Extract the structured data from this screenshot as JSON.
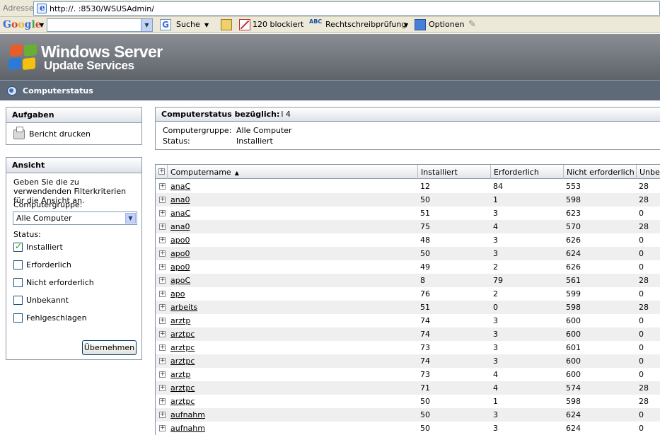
{
  "browser": {
    "address_label": "Adresse",
    "url": "http://.         :8530/WSUSAdmin/"
  },
  "google_toolbar": {
    "logo": "Google",
    "search_label": "Suche",
    "blocked_label": "120 blockiert",
    "spellcheck_label": "Rechtschreibprüfung",
    "options_label": "Optionen"
  },
  "banner": {
    "line1": "Windows Server",
    "line2": "Update Services"
  },
  "page": {
    "title": "Computerstatus"
  },
  "tasks": {
    "heading": "Aufgaben",
    "print_label": "Bericht drucken"
  },
  "view": {
    "heading": "Ansicht",
    "description": "Geben Sie die zu verwendenden Filterkriterien für die Ansicht an.",
    "group_label": "Computergruppe:",
    "group_value": "Alle Computer",
    "status_label": "Status:",
    "statuses": [
      {
        "label": "Installiert",
        "checked": true
      },
      {
        "label": "Erforderlich",
        "checked": false
      },
      {
        "label": "Nicht erforderlich",
        "checked": false
      },
      {
        "label": "Unbekannt",
        "checked": false
      },
      {
        "label": "Fehlgeschlagen",
        "checked": false
      }
    ],
    "apply_label": "Übernehmen"
  },
  "status_info": {
    "heading": "Computerstatus bezüglich:",
    "heading_value": "l          4",
    "rows": [
      {
        "key": "Computergruppe:",
        "value": "Alle Computer"
      },
      {
        "key": "Status:",
        "value": "Installiert"
      }
    ]
  },
  "table": {
    "columns": [
      "Computername",
      "Installiert",
      "Erforderlich",
      "Nicht erforderlich",
      "Unbekannt"
    ],
    "rows": [
      {
        "name": "anaC",
        "installed": "12",
        "required": "84",
        "not_required": "553",
        "unknown": "28"
      },
      {
        "name": "ana0",
        "installed": "50",
        "required": "1",
        "not_required": "598",
        "unknown": "28"
      },
      {
        "name": "anaC",
        "installed": "51",
        "required": "3",
        "not_required": "623",
        "unknown": "0"
      },
      {
        "name": "ana0",
        "installed": "75",
        "required": "4",
        "not_required": "570",
        "unknown": "28"
      },
      {
        "name": "apo0",
        "installed": "48",
        "required": "3",
        "not_required": "626",
        "unknown": "0"
      },
      {
        "name": "apo0",
        "installed": "50",
        "required": "3",
        "not_required": "624",
        "unknown": "0"
      },
      {
        "name": "apo0",
        "installed": "49",
        "required": "2",
        "not_required": "626",
        "unknown": "0"
      },
      {
        "name": "apoC",
        "installed": "8",
        "required": "79",
        "not_required": "561",
        "unknown": "28"
      },
      {
        "name": "apo",
        "installed": "76",
        "required": "2",
        "not_required": "599",
        "unknown": "0"
      },
      {
        "name": "arbeits",
        "installed": "51",
        "required": "0",
        "not_required": "598",
        "unknown": "28"
      },
      {
        "name": "arztp",
        "installed": "74",
        "required": "3",
        "not_required": "600",
        "unknown": "0"
      },
      {
        "name": "arztpc",
        "installed": "74",
        "required": "3",
        "not_required": "600",
        "unknown": "0"
      },
      {
        "name": "arztpc",
        "installed": "73",
        "required": "3",
        "not_required": "601",
        "unknown": "0"
      },
      {
        "name": "arztpc",
        "installed": "74",
        "required": "3",
        "not_required": "600",
        "unknown": "0"
      },
      {
        "name": "arztp",
        "installed": "73",
        "required": "4",
        "not_required": "600",
        "unknown": "0"
      },
      {
        "name": "arztpc",
        "installed": "71",
        "required": "4",
        "not_required": "574",
        "unknown": "28"
      },
      {
        "name": "arztpc",
        "installed": "50",
        "required": "1",
        "not_required": "598",
        "unknown": "28"
      },
      {
        "name": "aufnahm",
        "installed": "50",
        "required": "3",
        "not_required": "624",
        "unknown": "0"
      },
      {
        "name": "aufnahm",
        "installed": "50",
        "required": "3",
        "not_required": "624",
        "unknown": "0"
      }
    ]
  }
}
